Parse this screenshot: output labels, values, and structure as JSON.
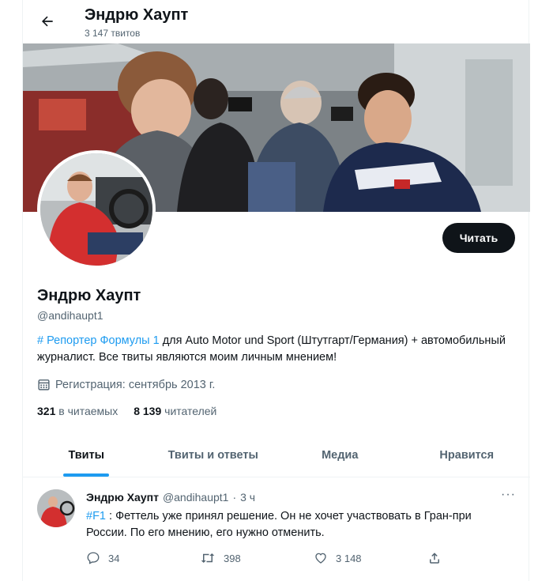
{
  "header": {
    "name": "Эндрю Хаупт",
    "tweet_count": "3 147 твитов"
  },
  "icons": {
    "back": "arrow-left-icon",
    "calendar": "calendar-icon",
    "more": "more-dots-icon",
    "reply": "reply-icon",
    "retweet": "retweet-icon",
    "like": "heart-icon",
    "share": "share-icon"
  },
  "profile": {
    "follow_label": "Читать",
    "name": "Эндрю Хаупт",
    "handle": "@andihaupt1",
    "bio_tag": "# Репортер Формулы 1",
    "bio_text": " для Auto Motor und Sport (Штутгарт/Германия) + автомобильный журналист. Все твиты являются моим личным мнением!",
    "joined": "Регистрация: сентябрь 2013 г.",
    "following_count": "321",
    "following_label": " в читаемых",
    "followers_count": "8 139",
    "followers_label": " читателей"
  },
  "tabs": [
    {
      "label": "Твиты",
      "active": true
    },
    {
      "label": "Твиты и ответы",
      "active": false
    },
    {
      "label": "Медиа",
      "active": false
    },
    {
      "label": "Нравится",
      "active": false
    }
  ],
  "tweet": {
    "name": "Эндрю Хаупт",
    "handle": "@andihaupt1",
    "separator": "·",
    "time": "3 ч",
    "tag": "#F1",
    "text": " : Феттель уже принял решение. Он не хочет участвовать в Гран-при России. По его мнению, его нужно отменить.",
    "replies": "34",
    "retweets": "398",
    "likes": "3 148"
  },
  "colors": {
    "accent": "#1d9bf0",
    "text": "#0f1419",
    "muted": "#536471",
    "button": "#0f1419"
  }
}
